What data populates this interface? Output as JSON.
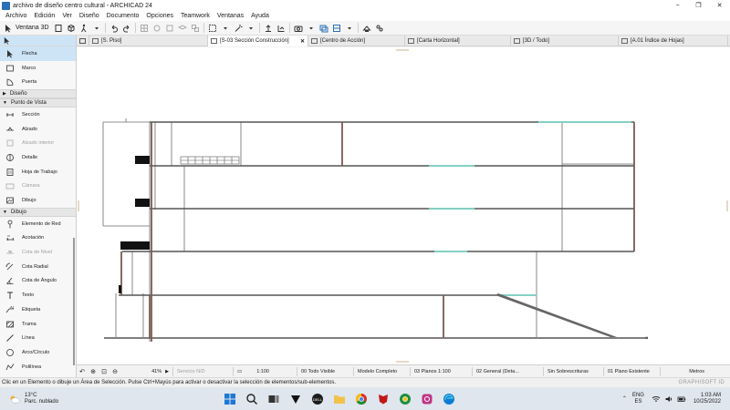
{
  "window": {
    "title": "archivo de diseño centro cultural - ARCHICAD 24",
    "minimize": "−",
    "maximize": "❐",
    "close": "✕"
  },
  "menu": [
    "Archivo",
    "Edición",
    "Ver",
    "Diseño",
    "Documento",
    "Opciones",
    "Teamwork",
    "Ventanas",
    "Ayuda"
  ],
  "toolbar": {
    "view3d_label": "Ventana 3D"
  },
  "tabs": [
    {
      "label": "[S. Piso]",
      "active": false
    },
    {
      "label": "[S-03 Sección Construcción]",
      "active": true,
      "close": "✕"
    },
    {
      "label": "[Centro de Acción]",
      "active": false
    },
    {
      "label": "[Carta Horizontal]",
      "active": false
    },
    {
      "label": "[3D / Todo]",
      "active": false
    },
    {
      "label": "[A.01 Índice de Hojas]",
      "active": false
    }
  ],
  "toolbox": {
    "top": [
      {
        "label": "Flecha",
        "icon": "arrow-icon",
        "selected": true
      },
      {
        "label": "Marco",
        "icon": "marquee-icon"
      },
      {
        "label": "Puerta",
        "icon": "door-icon"
      }
    ],
    "groups": [
      {
        "label": "Diseño",
        "collapsed": true,
        "items": []
      },
      {
        "label": "Punto de Vista",
        "collapsed": false,
        "items": [
          {
            "label": "Sección",
            "icon": "section-icon"
          },
          {
            "label": "Alzado",
            "icon": "elevation-icon"
          },
          {
            "label": "Alzado interior",
            "icon": "interior-elevation-icon",
            "disabled": true
          },
          {
            "label": "Detalle",
            "icon": "detail-icon"
          },
          {
            "label": "Hoja de Trabajo",
            "icon": "worksheet-icon"
          },
          {
            "label": "Cámara",
            "icon": "camera-icon",
            "disabled": true
          },
          {
            "label": "Dibujo",
            "icon": "drawing-icon"
          }
        ]
      },
      {
        "label": "Dibujo",
        "collapsed": false,
        "items": [
          {
            "label": "Elemento de Red",
            "icon": "grid-element-icon"
          },
          {
            "label": "Acotación",
            "icon": "dimension-icon"
          },
          {
            "label": "Cota de Nivel",
            "icon": "level-dimension-icon",
            "disabled": true
          },
          {
            "label": "Cota Radial",
            "icon": "radial-dimension-icon"
          },
          {
            "label": "Cota de Ángulo",
            "icon": "angle-dimension-icon"
          },
          {
            "label": "Texto",
            "icon": "text-icon"
          },
          {
            "label": "Etiqueta",
            "icon": "label-icon"
          },
          {
            "label": "Trama",
            "icon": "fill-icon"
          },
          {
            "label": "Línea",
            "icon": "line-icon"
          },
          {
            "label": "Arco/Círculo",
            "icon": "arc-icon"
          },
          {
            "label": "Polilínea",
            "icon": "polyline-icon"
          }
        ]
      }
    ]
  },
  "statusbar": {
    "zoom": "41%",
    "service": "Servicio N/D",
    "scale": "1:100",
    "layer_combo": "00 Todo Visible",
    "model_view": "Modelo Completo",
    "pen_set": "03 Planos 1:100",
    "dimension": "02 General (Deta...",
    "override": "Sin Sobrescrituras",
    "renovation": "01 Plano Existente",
    "units": "Metros"
  },
  "hint": "Clic en un Elemento o dibuje un Área de Selección. Pulse Ctrl+Mayús para activar o desactivar la selección de elementos/sub-elementos.",
  "brand": "GRAPHISOFT ID",
  "taskbar": {
    "temperature": "13°C",
    "weather": "Parc. nublado",
    "lang1": "ENG",
    "lang2": "ES",
    "time": "1:03 AM",
    "date": "10/25/2022"
  },
  "colors": {
    "accent": "#cde4f7",
    "wall": "#555555",
    "wall_cut": "#8a6a62",
    "glass": "#7fd6c8",
    "taskbar": "#dfe6ee"
  }
}
